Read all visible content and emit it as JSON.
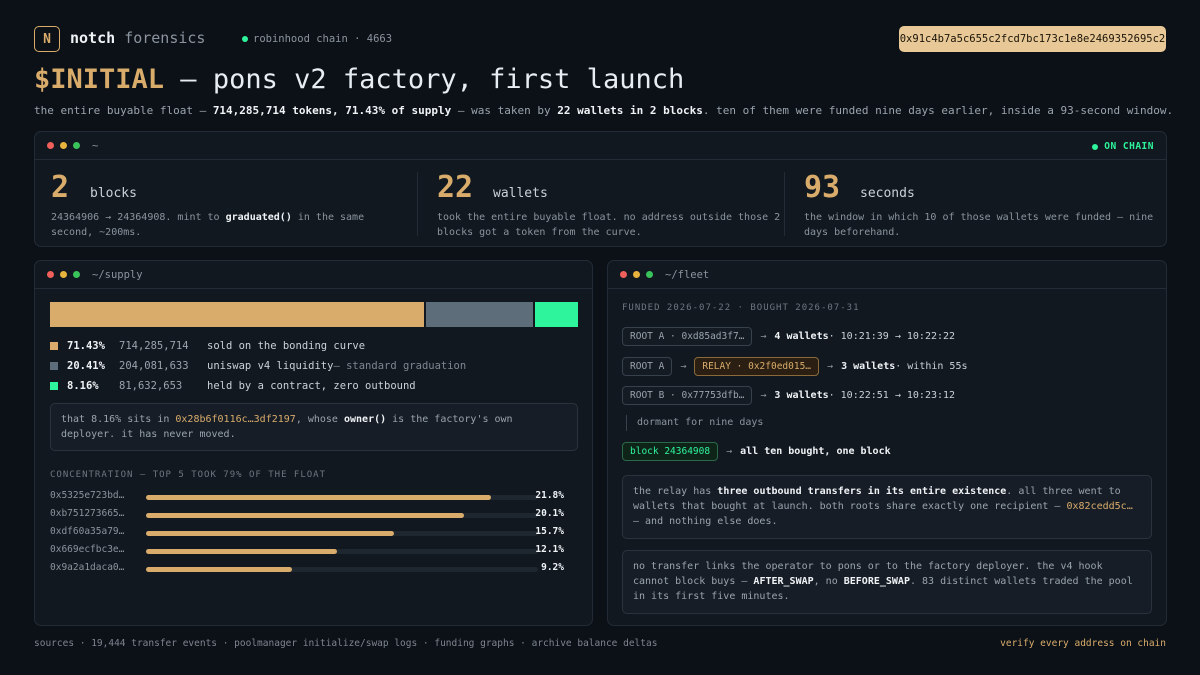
{
  "header": {
    "logo_letter": "N",
    "brand_primary": "notch",
    "brand_secondary": "forensics",
    "chain": "robinhood chain · 4663",
    "address": "0x91c4b7a5c655c2fcd7bc173c1e8e2469352695c2"
  },
  "title": {
    "symbol": "$INITIAL",
    "rest": " — pons v2 factory, first launch"
  },
  "subtitle": {
    "p1": "the entire buyable float — ",
    "b1": "714,285,714 tokens, 71.43% of supply",
    "p2": " — was taken by ",
    "b2": "22 wallets in 2 blocks",
    "p3": ". ten of them were funded nine days earlier, inside a 93-second window."
  },
  "stats_panel": {
    "path": "~",
    "status": "ON CHAIN",
    "stats": [
      {
        "num": "2",
        "unit": "blocks",
        "desc_a": "24364906 → 24364908. mint to ",
        "desc_b": "graduated()",
        "desc_c": " in the same second, ~200ms."
      },
      {
        "num": "22",
        "unit": "wallets",
        "desc": "took the entire buyable float. no address outside those 2 blocks got a token from the curve."
      },
      {
        "num": "93",
        "unit": "seconds",
        "desc": "the window in which 10 of those wallets were funded — nine days beforehand."
      }
    ]
  },
  "supply_panel": {
    "path": "~/supply",
    "segments": [
      {
        "pct_value": 71.43,
        "color": "#d9ac6b"
      },
      {
        "pct_value": 20.41,
        "color": "#5e6d7a"
      },
      {
        "pct_value": 8.16,
        "color": "#2ef59b"
      }
    ],
    "legend": [
      {
        "pct": "71.43%",
        "amount": "714,285,714",
        "desc": "sold on the bonding curve",
        "note": "",
        "color": "#d9ac6b"
      },
      {
        "pct": "20.41%",
        "amount": "204,081,633",
        "desc": "uniswap v4 liquidity",
        "note": " — standard graduation",
        "color": "#5e6d7a"
      },
      {
        "pct": "8.16%",
        "amount": "81,632,653",
        "desc": "held by a contract, zero outbound",
        "note": "",
        "color": "#2ef59b"
      }
    ],
    "callout": {
      "p1": "that 8.16% sits in ",
      "addr": "0x28b6f0116c…3df2197",
      "p2": ", whose ",
      "b": "owner()",
      "p3": " is the factory's own deployer. it has never moved."
    },
    "concentration_label": "CONCENTRATION — TOP 5 TOOK 79% OF THE FLOAT",
    "concentration": [
      {
        "addr": "0x5325e723bd…",
        "pct": "21.8%",
        "value": 21.8
      },
      {
        "addr": "0xb751273665…",
        "pct": "20.1%",
        "value": 20.1
      },
      {
        "addr": "0xdf60a35a79…",
        "pct": "15.7%",
        "value": 15.7
      },
      {
        "addr": "0x669ecfbc3e…",
        "pct": "12.1%",
        "value": 12.1
      },
      {
        "addr": "0x9a2a1daca0…",
        "pct": "9.2%",
        "value": 9.2
      }
    ]
  },
  "fleet_panel": {
    "path": "~/fleet",
    "label": "FUNDED 2026-07-22 · BOUGHT 2026-07-31",
    "rows": {
      "r1_chip": "ROOT A · 0xd85ad3f7…",
      "r1_bold": "4 wallets",
      "r1_rest": " · 10:21:39 → 10:22:22",
      "r2_chip": "ROOT A",
      "r2_relay": "RELAY · 0x2f0ed015…",
      "r2_bold": "3 wallets",
      "r2_rest": " · within 55s",
      "r3_chip": "ROOT B · 0x77753dfb…",
      "r3_bold": "3 wallets",
      "r3_rest": " · 10:22:51 → 10:23:12",
      "dormant": "dormant for nine days",
      "r4_chip": "block 24364908",
      "r4_bold": "all ten bought, one block"
    },
    "arrow": "→",
    "note1": {
      "p1": "the relay has ",
      "b": "three outbound transfers in its entire existence",
      "p2": ". all three went to wallets that bought at launch. both roots share exactly one recipient — ",
      "addr": "0x82cedd5c…",
      "p3": " — and nothing else does."
    },
    "note2": {
      "p1": "no transfer links the operator to pons or to the factory deployer. the v4 hook cannot block buys — ",
      "b1": "AFTER_SWAP",
      "p2": ", no ",
      "b2": "BEFORE_SWAP",
      "p3": ". 83 distinct wallets traded the pool in its first five minutes."
    }
  },
  "footer": {
    "sources": "sources · 19,444 transfer events · poolmanager initialize/swap logs · funding graphs · archive balance deltas",
    "verify": "verify every address on chain"
  },
  "colors": {
    "accent": "#d9ac6b",
    "green": "#2ef59b",
    "slate": "#5e6d7a",
    "background": "#0c1117"
  }
}
